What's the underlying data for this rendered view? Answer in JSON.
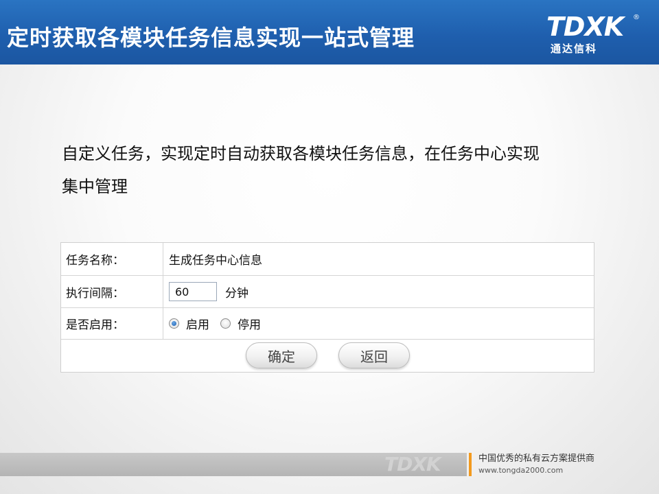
{
  "header": {
    "title": "定时获取各模块任务信息实现一站式管理",
    "logo_mark": "TDXK",
    "logo_reg": "®",
    "logo_cn": "通达信科"
  },
  "description": {
    "line1": "自定义任务，实现定时自动获取各模块任务信息，在任务中心实现",
    "line2": "集中管理"
  },
  "form": {
    "task_name_label": "任务名称：",
    "task_name_value": "生成任务中心信息",
    "interval_label": "执行间隔：",
    "interval_value": "60",
    "interval_unit": "分钟",
    "enabled_label": "是否启用：",
    "options": [
      {
        "label": "启用",
        "checked": true
      },
      {
        "label": "停用",
        "checked": false
      }
    ],
    "confirm_label": "确定",
    "back_label": "返回"
  },
  "footer": {
    "watermark": "TDXK",
    "slogan": "中国优秀的私有云方案提供商",
    "url": "www.tongda2000.com"
  },
  "colors": {
    "header_blue": "#1f5fae",
    "accent_orange": "#f39a1e",
    "radio_blue": "#1b5fb0"
  }
}
